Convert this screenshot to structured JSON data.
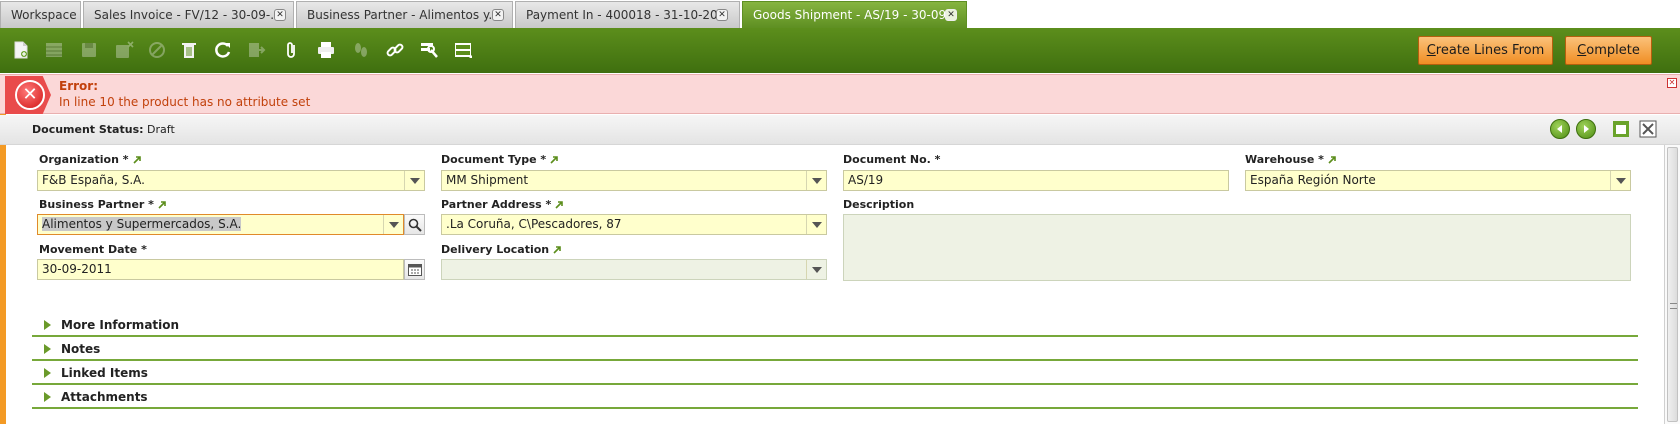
{
  "tabs": [
    {
      "label": "Workspace",
      "closable": false
    },
    {
      "label": "Sales Invoice - FV/12 - 30-09-...",
      "closable": true
    },
    {
      "label": "Business Partner - Alimentos y...",
      "closable": true
    },
    {
      "label": "Payment In - 400018 - 31-10-20...",
      "closable": true
    },
    {
      "label": "Goods Shipment - AS/19 - 30-09...",
      "closable": true,
      "active": true
    }
  ],
  "toolbar": {
    "icons": [
      "new-document-icon",
      "grid-view-icon",
      "save-icon",
      "save-close-icon",
      "undo-icon",
      "delete-icon",
      "refresh-icon",
      "export-icon",
      "attachment-icon",
      "print-icon",
      "audit-trail-icon",
      "link-icon",
      "tools-icon",
      "layout-icon"
    ],
    "create_lines_label_u": "C",
    "create_lines_label_rest": "reate Lines From",
    "complete_label_u": "C",
    "complete_label_rest": "omplete"
  },
  "error": {
    "title": "Error:",
    "message": "In line 10 the product has no attribute set"
  },
  "status": {
    "label": "Document Status:",
    "value": "Draft"
  },
  "form": {
    "organization": {
      "label": "Organization *",
      "value": "F&B España, S.A."
    },
    "document_type": {
      "label": "Document Type *",
      "value": "MM Shipment"
    },
    "document_no": {
      "label": "Document No. *",
      "value": "AS/19"
    },
    "warehouse": {
      "label": "Warehouse *",
      "value": "España Región Norte"
    },
    "business_partner": {
      "label": "Business Partner *",
      "value": "Alimentos y Supermercados, S.A."
    },
    "partner_address": {
      "label": "Partner Address *",
      "value": ".La Coruña, C\\Pescadores, 87"
    },
    "description": {
      "label": "Description",
      "value": ""
    },
    "movement_date": {
      "label": "Movement Date *",
      "value": "30-09-2011"
    },
    "delivery_location": {
      "label": "Delivery Location",
      "value": ""
    }
  },
  "sections": [
    {
      "title": "More Information"
    },
    {
      "title": "Notes"
    },
    {
      "title": "Linked Items"
    },
    {
      "title": "Attachments"
    }
  ],
  "colors": {
    "accent_green": "#5c8e1c",
    "error_bg": "#fbd8d8",
    "error_text": "#c2410c",
    "field_bg": "#ffffcc",
    "button_orange": "#f08d23"
  }
}
